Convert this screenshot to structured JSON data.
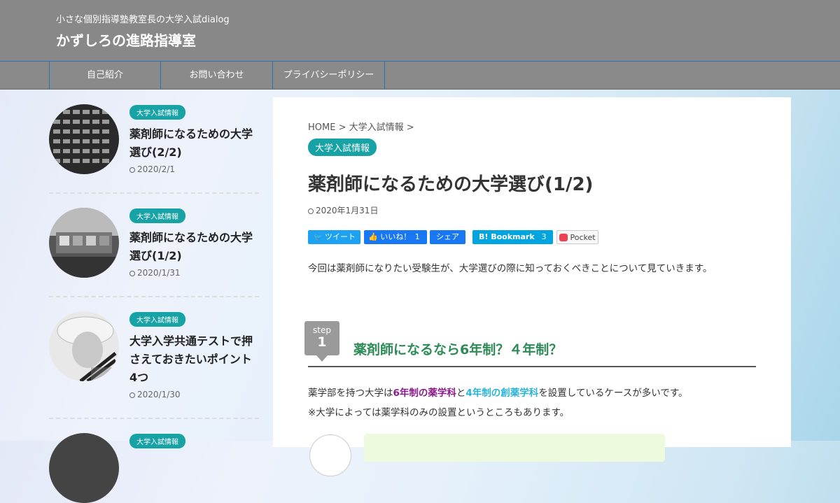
{
  "header": {
    "tagline": "小さな個別指導塾教室長の大学入試dialog",
    "site_name": "かずしろの進路指導室"
  },
  "nav": {
    "items": [
      {
        "label": "自己紹介"
      },
      {
        "label": "お問い合わせ"
      },
      {
        "label": "プライバシーポリシー"
      }
    ]
  },
  "sidebar": {
    "posts": [
      {
        "category": "大学入試情報",
        "title": "薬剤師になるための大学選び(2/2)",
        "date": "2020/2/1"
      },
      {
        "category": "大学入試情報",
        "title": "薬剤師になるための大学選び(1/2)",
        "date": "2020/1/31"
      },
      {
        "category": "大学入試情報",
        "title": "大学入学共通テストで押さえておきたいポイント4つ",
        "date": "2020/1/30"
      },
      {
        "category": "大学入試情報"
      }
    ]
  },
  "article": {
    "breadcrumb": {
      "home": "HOME",
      "sep1": ">",
      "category": "大学入試情報",
      "sep2": ">"
    },
    "category": "大学入試情報",
    "title": "薬剤師になるための大学選び(1/2)",
    "date": "2020年1月31日",
    "share": {
      "tweet": "ツイート",
      "like": "いいね！",
      "like_count": "1",
      "share": "シェア",
      "hatena": "B! Bookmark",
      "hatena_count": "3",
      "pocket": "Pocket"
    },
    "intro": "今回は薬剤師になりたい受験生が、大学選びの際に知っておくべきことについて見ていきます。",
    "step": {
      "label": "step",
      "number": "1"
    },
    "heading": "薬剤師になるなら6年制？４年制？",
    "para1": {
      "before": "薬学部を持つ大学は",
      "hl1": "6年制の薬学科",
      "mid": "と",
      "hl2": "4年制の創薬学科",
      "after": "を設置しているケースが多いです。"
    },
    "para2": "※大学によっては薬学科のみの設置というところもあります。"
  },
  "colors": {
    "accent": "#17a2a6",
    "header_bg": "#888888",
    "heading_green": "#2e8b57",
    "highlight_purple": "#8b1a8b",
    "highlight_blue": "#2bb4d6"
  }
}
